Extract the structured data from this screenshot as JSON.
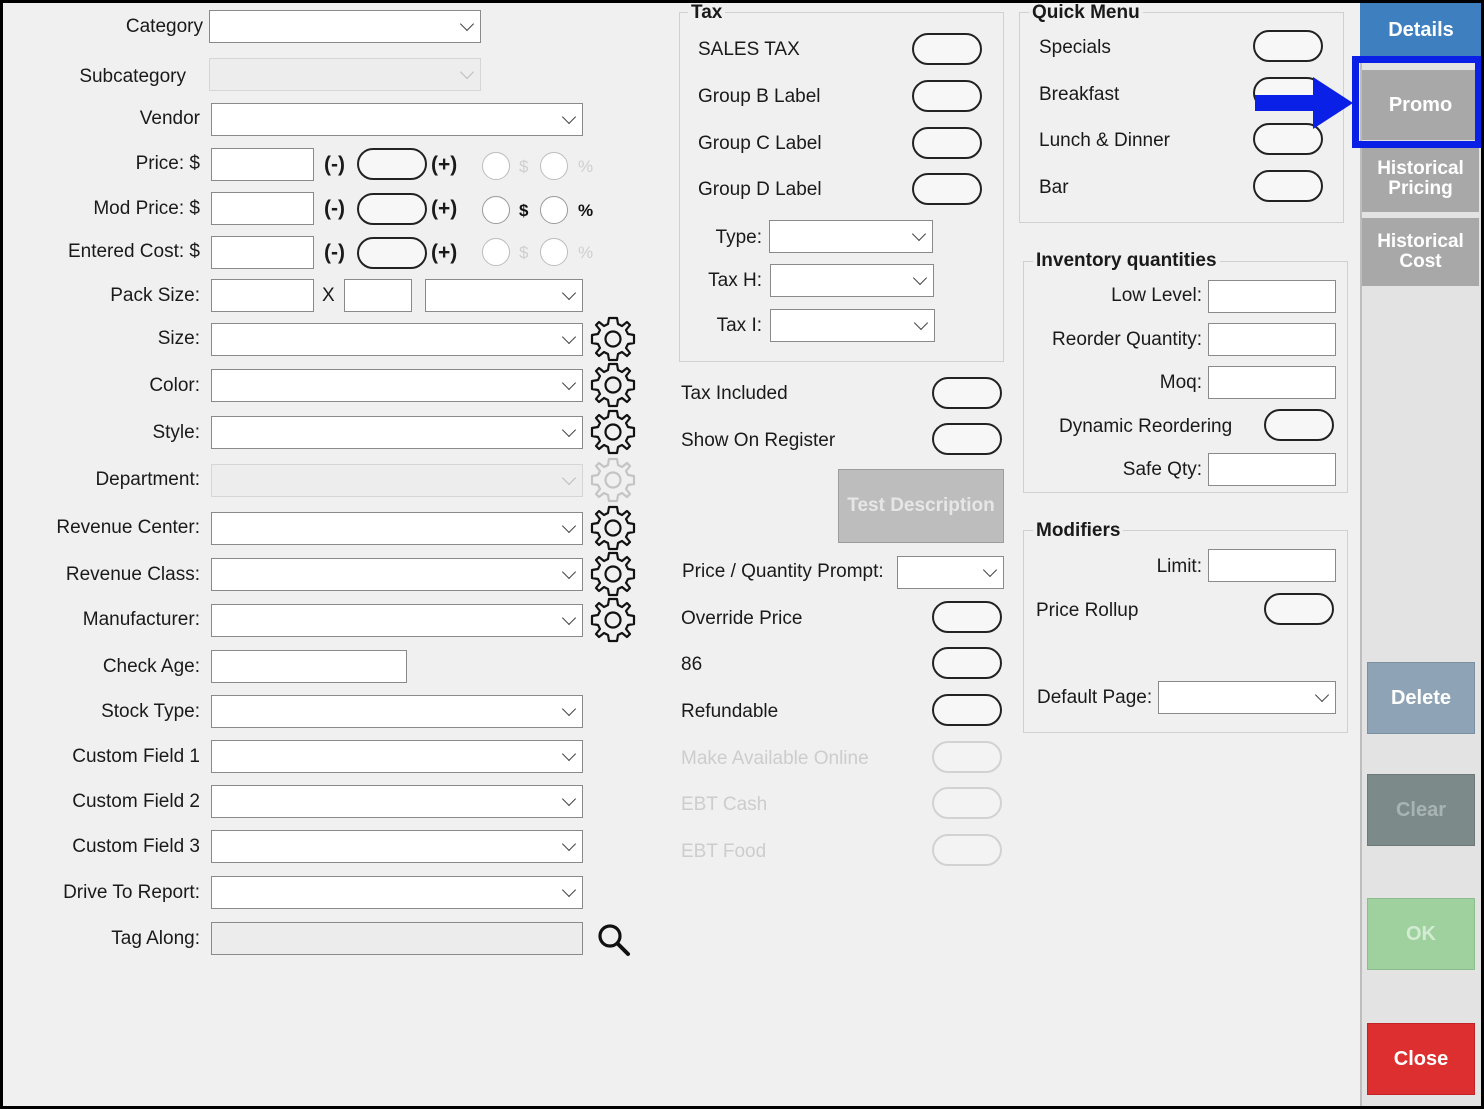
{
  "left_form": {
    "category_label": "Category",
    "subcategory_label": "Subcategory",
    "vendor_label": "Vendor",
    "price_label": "Price: $",
    "mod_price_label": "Mod Price: $",
    "entered_cost_label": "Entered Cost: $",
    "pack_size_label": "Pack Size:",
    "pack_x": "X",
    "size_label": "Size:",
    "color_label": "Color:",
    "style_label": "Style:",
    "department_label": "Department:",
    "revenue_center_label": "Revenue Center:",
    "revenue_class_label": "Revenue Class:",
    "manufacturer_label": "Manufacturer:",
    "check_age_label": "Check Age:",
    "stock_type_label": "Stock Type:",
    "custom_field_1_label": "Custom Field 1",
    "custom_field_2_label": "Custom Field 2",
    "custom_field_3_label": "Custom Field 3",
    "drive_to_report_label": "Drive To Report:",
    "tag_along_label": "Tag Along:",
    "minus": "(-)",
    "plus": "(+)",
    "dollar": "$",
    "percent": "%"
  },
  "tax": {
    "title": "Tax",
    "sales_tax": "SALES TAX",
    "group_b": "Group B Label",
    "group_c": "Group C Label",
    "group_d": "Group D Label",
    "type_label": "Type:",
    "tax_h_label": "Tax H:",
    "tax_i_label": "Tax I:"
  },
  "middle": {
    "tax_included": "Tax Included",
    "show_on_register": "Show On Register",
    "test_description": "Test Description",
    "price_qty_prompt": "Price / Quantity Prompt:",
    "override_price": "Override Price",
    "eighty_six": "86",
    "refundable": "Refundable",
    "make_available_online": "Make Available Online",
    "ebt_cash": "EBT Cash",
    "ebt_food": "EBT Food"
  },
  "quick_menu": {
    "title": "Quick Menu",
    "items": [
      "Specials",
      "Breakfast",
      "Lunch & Dinner",
      "Bar"
    ]
  },
  "inventory": {
    "title": "Inventory quantities",
    "low_level": "Low Level:",
    "reorder_quantity": "Reorder Quantity:",
    "moq": "Moq:",
    "dynamic_reordering": "Dynamic Reordering",
    "safe_qty": "Safe Qty:"
  },
  "modifiers": {
    "title": "Modifiers",
    "limit": "Limit:",
    "price_rollup": "Price Rollup",
    "default_page": "Default Page:"
  },
  "sidebar": {
    "details": "Details",
    "promo": "Promo",
    "historical_pricing": "Historical Pricing",
    "historical_cost": "Historical Cost",
    "delete": "Delete",
    "clear": "Clear",
    "ok": "OK",
    "close": "Close"
  },
  "colors": {
    "details": "#3d7fbf",
    "promo": "#a8a8a8",
    "historical": "#a8a8a8",
    "delete": "#8ea4b6",
    "clear": "#7d8a8a",
    "ok": "#9ed19e",
    "close": "#dd2f2f",
    "highlight": "#0b20e6"
  }
}
